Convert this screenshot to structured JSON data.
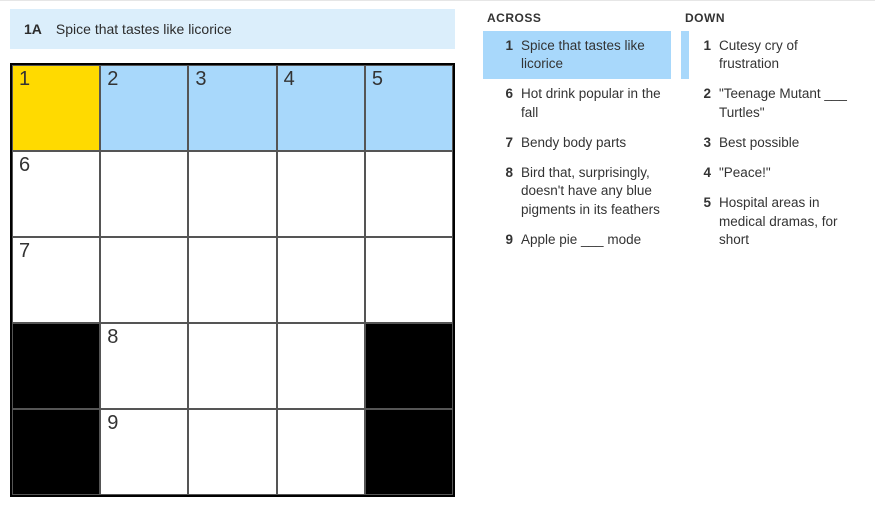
{
  "current_clue": {
    "label": "1A",
    "text": "Spice that tastes like licorice"
  },
  "grid": {
    "rows": 5,
    "cols": 5,
    "cells": [
      [
        {
          "num": "1",
          "state": "cursor"
        },
        {
          "num": "2",
          "state": "hl"
        },
        {
          "num": "3",
          "state": "hl"
        },
        {
          "num": "4",
          "state": "hl"
        },
        {
          "num": "5",
          "state": "hl"
        }
      ],
      [
        {
          "num": "6",
          "state": ""
        },
        {
          "num": "",
          "state": ""
        },
        {
          "num": "",
          "state": ""
        },
        {
          "num": "",
          "state": ""
        },
        {
          "num": "",
          "state": ""
        }
      ],
      [
        {
          "num": "7",
          "state": ""
        },
        {
          "num": "",
          "state": ""
        },
        {
          "num": "",
          "state": ""
        },
        {
          "num": "",
          "state": ""
        },
        {
          "num": "",
          "state": ""
        }
      ],
      [
        {
          "num": "",
          "state": "black"
        },
        {
          "num": "8",
          "state": ""
        },
        {
          "num": "",
          "state": ""
        },
        {
          "num": "",
          "state": ""
        },
        {
          "num": "",
          "state": "black"
        }
      ],
      [
        {
          "num": "",
          "state": "black"
        },
        {
          "num": "9",
          "state": ""
        },
        {
          "num": "",
          "state": ""
        },
        {
          "num": "",
          "state": ""
        },
        {
          "num": "",
          "state": "black"
        }
      ]
    ]
  },
  "across": {
    "heading": "ACROSS",
    "clues": [
      {
        "num": "1",
        "text": "Spice that tastes like licorice",
        "state": "selected"
      },
      {
        "num": "6",
        "text": "Hot drink popular in the fall",
        "state": ""
      },
      {
        "num": "7",
        "text": "Bendy body parts",
        "state": ""
      },
      {
        "num": "8",
        "text": "Bird that, surprisingly, doesn't have any blue pigments in its feathers",
        "state": ""
      },
      {
        "num": "9",
        "text": "Apple pie ___ mode",
        "state": ""
      }
    ]
  },
  "down": {
    "heading": "DOWN",
    "clues": [
      {
        "num": "1",
        "text": "Cutesy cry of frustration",
        "state": "related"
      },
      {
        "num": "2",
        "text": "\"Teenage Mutant ___ Turtles\"",
        "state": ""
      },
      {
        "num": "3",
        "text": "Best possible",
        "state": ""
      },
      {
        "num": "4",
        "text": "\"Peace!\"",
        "state": ""
      },
      {
        "num": "5",
        "text": "Hospital areas in medical dramas, for short",
        "state": ""
      }
    ]
  }
}
